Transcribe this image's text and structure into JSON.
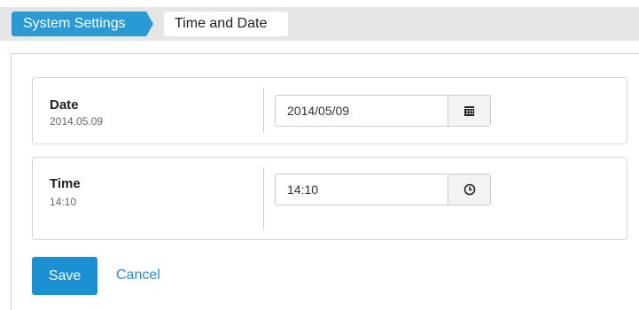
{
  "breadcrumb": {
    "parent": "System Settings",
    "current": "Time and Date"
  },
  "date_row": {
    "label": "Date",
    "current_value": "2014.05.09",
    "input_value": "2014/05/09",
    "icon": "calendar-icon"
  },
  "time_row": {
    "label": "Time",
    "current_value": "14:10",
    "input_value": "14:10",
    "icon": "clock-icon"
  },
  "actions": {
    "save_label": "Save",
    "cancel_label": "Cancel"
  },
  "colors": {
    "accent": "#1a8fd2",
    "link": "#2a8fd0",
    "topbar": "#e6e6e6"
  }
}
